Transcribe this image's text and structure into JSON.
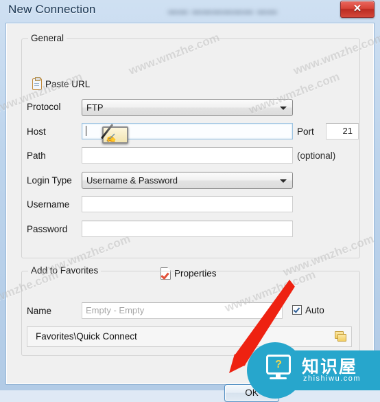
{
  "window": {
    "title": "New Connection",
    "close_label": "✕",
    "background_blur_text": "▬▬  ▬▬▬▬▬▬  ▬▬"
  },
  "general": {
    "group_title": "General",
    "paste_url_label": "Paste URL",
    "fields": {
      "protocol": {
        "label": "Protocol",
        "value": "FTP"
      },
      "host": {
        "label": "Host",
        "value": ""
      },
      "port": {
        "label": "Port",
        "value": "21"
      },
      "path": {
        "label": "Path",
        "value": "",
        "hint": "(optional)"
      },
      "login_type": {
        "label": "Login Type",
        "value": "Username & Password"
      },
      "username": {
        "label": "Username",
        "value": ""
      },
      "password": {
        "label": "Password",
        "value": ""
      }
    },
    "properties_label": "Properties"
  },
  "favorites": {
    "group_title": "Add to Favorites",
    "name_label": "Name",
    "name_placeholder": "Empty - Empty",
    "auto_label": "Auto",
    "path_value": "Favorites\\Quick Connect"
  },
  "buttons": {
    "ok_label": "OK"
  },
  "overlays": {
    "watermark_text": "www.wmzhe.com",
    "brand_cn": "知识屋",
    "brand_url": "zhishiwu.com",
    "brand_question": "?"
  },
  "colors": {
    "accent_blue": "#5591c4",
    "close_red": "#d84437",
    "arrow_red": "#ee2211",
    "brand_teal": "#27a6cc",
    "check_blue": "#2f5f97",
    "folder_yellow": "#f3cf63"
  }
}
